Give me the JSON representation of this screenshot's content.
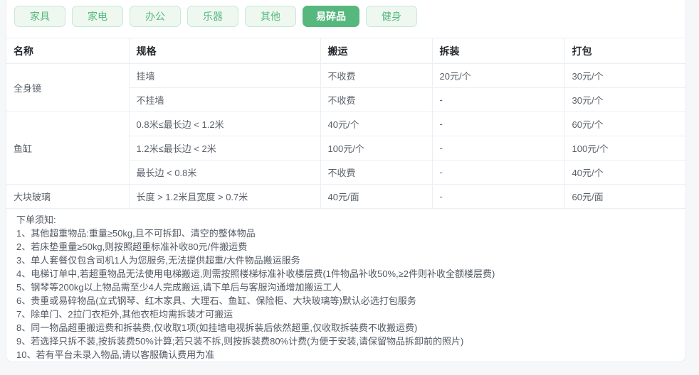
{
  "colors": {
    "accent_green": "#56b87d",
    "tab_inactive_bg": "#eef8f1",
    "tab_inactive_border": "#c9e7d4",
    "table_border": "#ebeef5"
  },
  "tabs": [
    {
      "id": "furniture",
      "label": "家具",
      "active": false
    },
    {
      "id": "appliance",
      "label": "家电",
      "active": false
    },
    {
      "id": "office",
      "label": "办公",
      "active": false
    },
    {
      "id": "instrument",
      "label": "乐器",
      "active": false
    },
    {
      "id": "other",
      "label": "其他",
      "active": false
    },
    {
      "id": "fragile",
      "label": "易碎品",
      "active": true
    },
    {
      "id": "fitness",
      "label": "健身",
      "active": false
    }
  ],
  "table": {
    "headers": [
      "名称",
      "规格",
      "搬运",
      "拆装",
      "打包"
    ],
    "groups": [
      {
        "name": "全身镜",
        "rows": [
          {
            "spec": "挂墙",
            "move": "不收费",
            "disassembly": "20元/个",
            "pack": "30元/个"
          },
          {
            "spec": "不挂墙",
            "move": "不收费",
            "disassembly": "-",
            "pack": "30元/个"
          }
        ]
      },
      {
        "name": "鱼缸",
        "rows": [
          {
            "spec": "0.8米≤最长边 < 1.2米",
            "move": "40元/个",
            "disassembly": "-",
            "pack": "60元/个"
          },
          {
            "spec": "1.2米≤最长边 < 2米",
            "move": "100元/个",
            "disassembly": "-",
            "pack": "100元/个"
          },
          {
            "spec": "最长边 < 0.8米",
            "move": "不收费",
            "disassembly": "-",
            "pack": "40元/个"
          }
        ]
      },
      {
        "name": "大块玻璃",
        "rows": [
          {
            "spec": "长度 > 1.2米且宽度 > 0.7米",
            "move": "40元/面",
            "disassembly": "-",
            "pack": "60元/面"
          }
        ]
      }
    ]
  },
  "notes": {
    "title": "下单须知:",
    "items": [
      "1、其他超重物品:重量≥50kg,且不可拆卸、清空的整体物品",
      "2、若床垫重量≥50kg,则按照超重标准补收80元/件搬运费",
      "3、单人套餐仅包含司机1人为您服务,无法提供超重/大件物品搬运服务",
      "4、电梯订单中,若超重物品无法使用电梯搬运,则需按照楼梯标准补收楼层费(1件物品补收50%,≥2件则补收全额楼层费)",
      "5、钢琴等200kg以上物品需至少4人完成搬运,请下单后与客服沟通增加搬运工人",
      "6、贵重或易碎物品(立式钢琴、红木家具、大理石、鱼缸、保险柜、大块玻璃等)默认必选打包服务",
      "7、除单门、2拉门衣柜外,其他衣柜均需拆装才可搬运",
      "8、同一物品超重搬运费和拆装费,仅收取1项(如挂墙电视拆装后依然超重,仅收取拆装费不收搬运费)",
      "9、若选择只拆不装,按拆装费50%计算;若只装不拆,则按拆装费80%计费(为便于安装,请保留物品拆卸前的照片)",
      "10、若有平台未录入物品,请以客服确认费用为准"
    ]
  }
}
